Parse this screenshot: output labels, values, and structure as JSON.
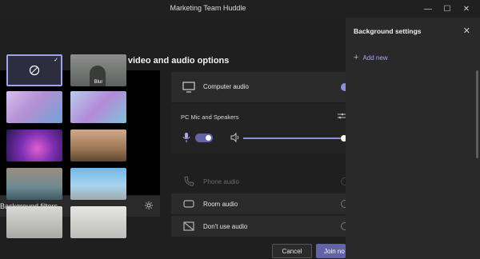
{
  "window": {
    "title": "Marketing Team Huddle"
  },
  "main": {
    "heading": "Choose your video and audio options",
    "background_filters_label": "Background filters"
  },
  "audio": {
    "computer_audio": "Computer audio",
    "device": "PC Mic and Speakers",
    "phone_audio": "Phone audio",
    "room_audio": "Room audio",
    "dont_use_audio": "Don't use audio",
    "selected": "Computer audio",
    "speaker_volume": 1.0
  },
  "buttons": {
    "cancel": "Cancel",
    "join": "Join no"
  },
  "panel": {
    "title": "Background settings",
    "add_new": "Add new",
    "blur_label": "Blur",
    "selected_background": "none"
  },
  "colors": {
    "accent": "#6264a7",
    "accent_light": "#a7a9f0"
  }
}
